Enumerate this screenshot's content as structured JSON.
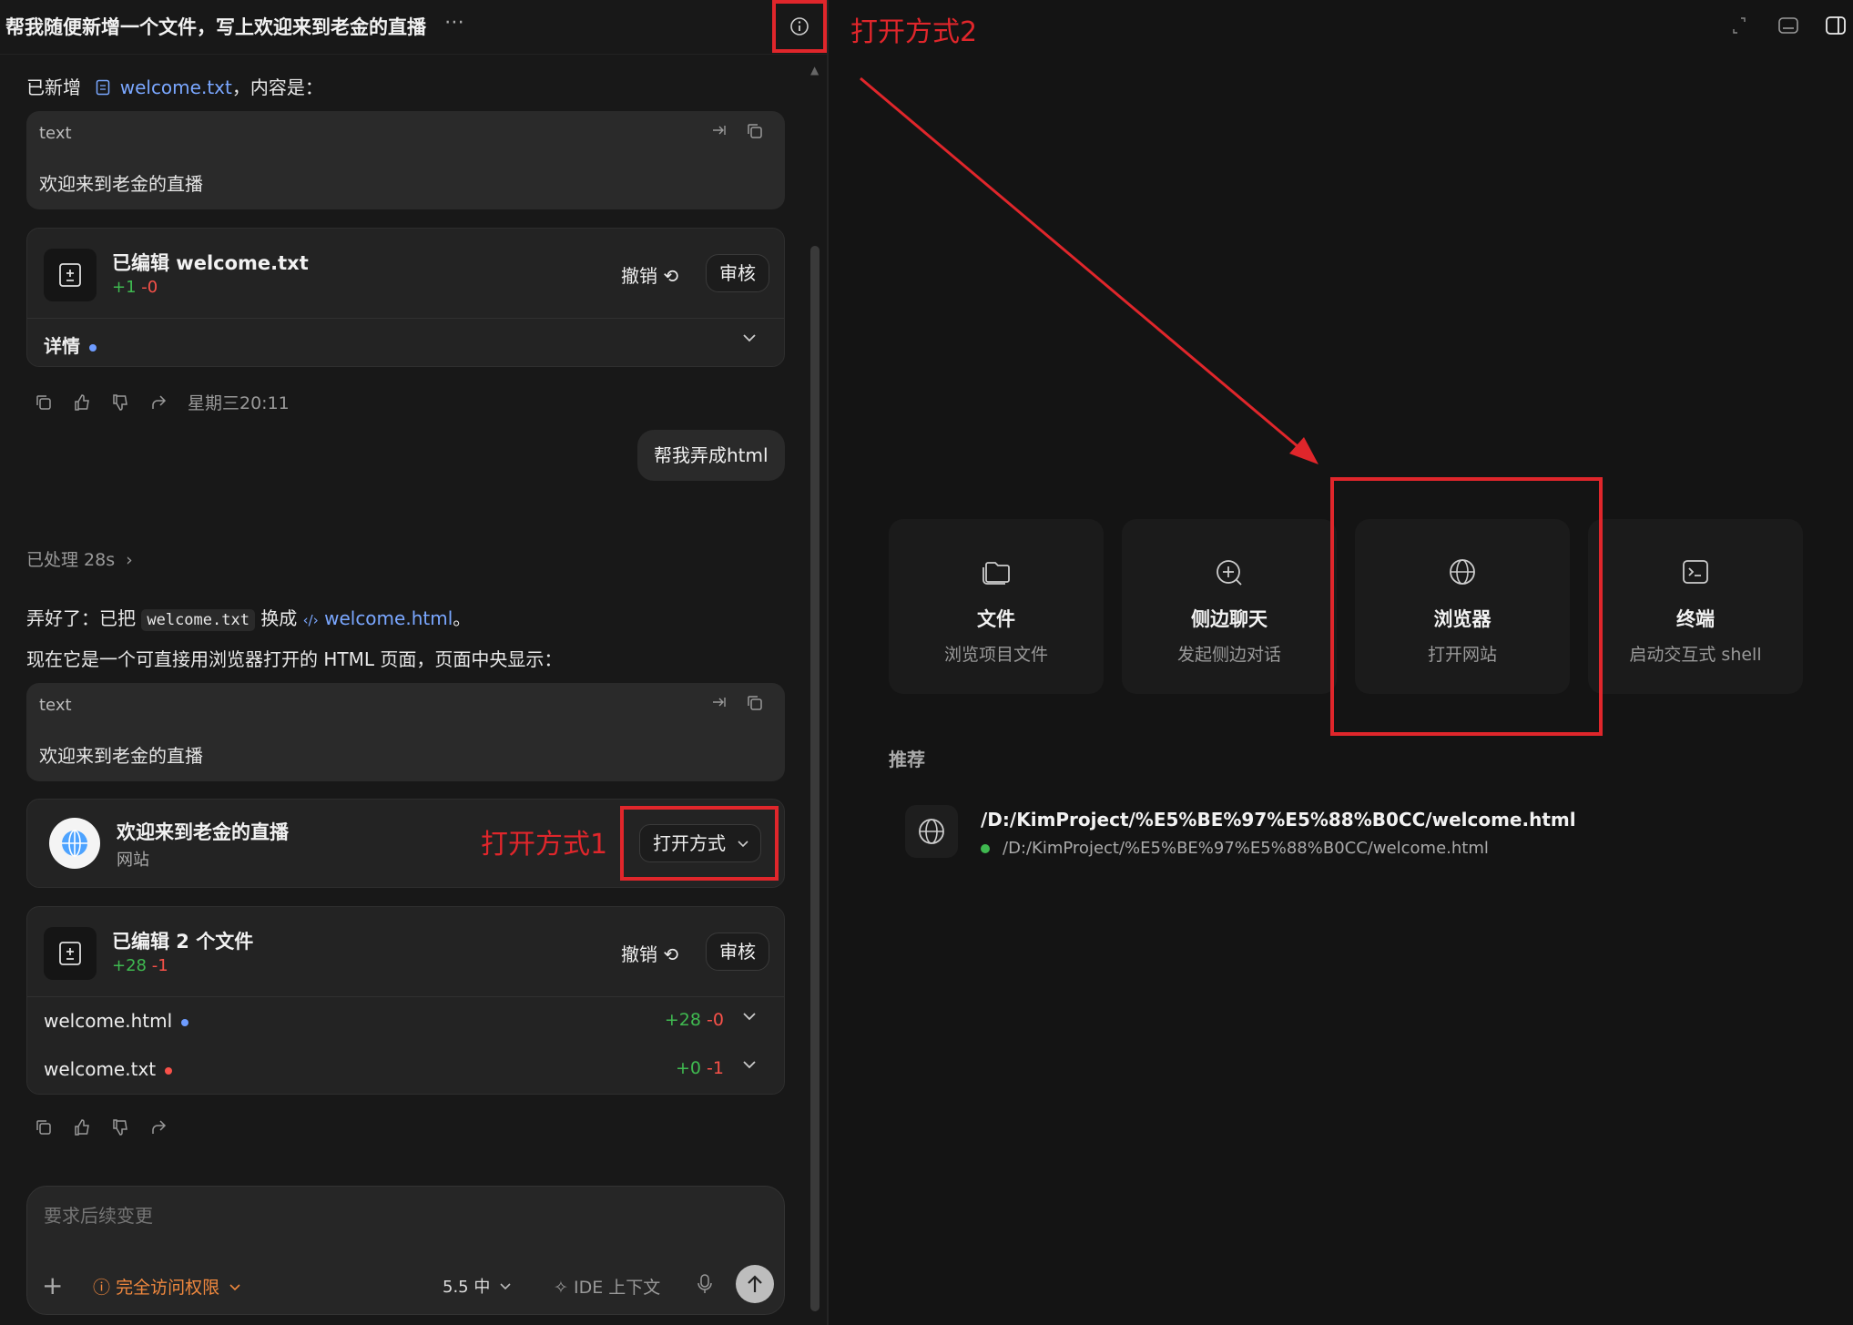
{
  "header": {
    "title": "帮我随便新增一个文件，写上欢迎来到老金的直播",
    "more_label": "⋯"
  },
  "msg1": {
    "prefix": "已新增",
    "file_link": "welcome.txt",
    "suffix": "，内容是："
  },
  "code1": {
    "lang": "text",
    "content": "欢迎来到老金的直播"
  },
  "edit_card1": {
    "title": "已编辑 welcome.txt",
    "added": "+1",
    "removed": "-0",
    "undo_label": "撤销",
    "review_label": "审核",
    "details_label": "详情"
  },
  "timestamp": "星期三20:11",
  "user_bubble": "帮我弄成html",
  "processed": "已处理 28s",
  "msg2": {
    "part1": "弄好了：已把",
    "code_a": "welcome.txt",
    "part2": "换成",
    "file_link": "welcome.html",
    "part3": "。",
    "line2": "现在它是一个可直接用浏览器打开的 HTML 页面，页面中央显示："
  },
  "code2": {
    "lang": "text",
    "content": "欢迎来到老金的直播"
  },
  "web_card": {
    "title": "欢迎来到老金的直播",
    "subtitle": "网站",
    "open_label": "打开方式"
  },
  "annotations": {
    "open_way_1": "打开方式1",
    "open_way_2": "打开方式2",
    "color": "#e0262b"
  },
  "edit_card2": {
    "title": "已编辑 2 个文件",
    "added": "+28",
    "removed": "-1",
    "undo_label": "撤销",
    "review_label": "审核",
    "files": [
      {
        "name": "welcome.html",
        "added": "+28",
        "removed": "-0",
        "dot_color": "#6e9cff"
      },
      {
        "name": "welcome.txt",
        "added": "+0",
        "removed": "-1",
        "dot_color": "#f85149"
      }
    ]
  },
  "composer": {
    "placeholder": "要求后续变更",
    "permission": "完全访问权限",
    "model": "5.5 中",
    "ide_context": "IDE 上下文"
  },
  "tiles": [
    {
      "title": "文件",
      "subtitle": "浏览项目文件",
      "icon": "folder-icon"
    },
    {
      "title": "侧边聊天",
      "subtitle": "发起侧边对话",
      "icon": "chat-plus-icon"
    },
    {
      "title": "浏览器",
      "subtitle": "打开网站",
      "icon": "globe-icon"
    },
    {
      "title": "终端",
      "subtitle": "启动交互式 shell",
      "icon": "terminal-icon"
    }
  ],
  "recommend": {
    "label": "推荐",
    "title": "/D:/KimProject/%E5%BE%97%E5%88%B0CC/welcome.html",
    "subtitle": "/D:/KimProject/%E5%BE%97%E5%88%B0CC/welcome.html"
  }
}
